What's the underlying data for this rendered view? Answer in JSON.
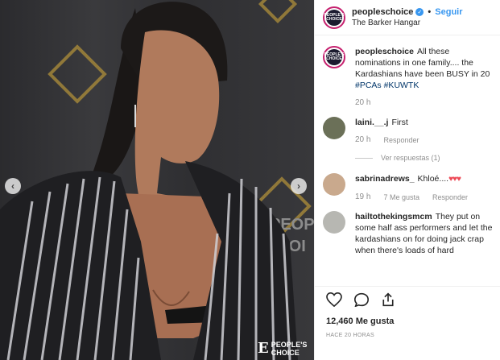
{
  "post": {
    "username": "peopleschoice",
    "follow_label": "Seguir",
    "separator": "•",
    "location": "The Barker Hangar",
    "avatar_text": "PEOPLE'S CHOICE"
  },
  "caption": {
    "username": "peopleschoice",
    "text": "All these nominations in one family.... the Kardashians have been BUSY in 20",
    "tags": "#PCAs #KUWTK",
    "time": "20 h"
  },
  "comments": [
    {
      "username": "laini.__.j",
      "text": "First",
      "time": "20 h",
      "reply_label": "Responder",
      "see_replies": "Ver respuestas (1)"
    },
    {
      "username": "sabrinadrews_",
      "text": "Khloé....",
      "hearts": "♥♥♥",
      "time": "19 h",
      "likes": "7 Me gusta",
      "reply_label": "Responder"
    },
    {
      "username": "hailtothekingsmcm",
      "text": "They put on some half ass performers and let the kardashians on for doing jack crap when there's loads of hard"
    }
  ],
  "footer": {
    "likes": "12,460 Me gusta",
    "time_ago": "HACE 20 HORAS"
  },
  "photo": {
    "watermark_e": "E",
    "watermark_text": "PEOPLE'S CHOICE",
    "prev": "‹",
    "next": "›"
  },
  "colors": {
    "accent": "#3897f0",
    "heart": "#ed4956",
    "hashtag": "#003569"
  }
}
